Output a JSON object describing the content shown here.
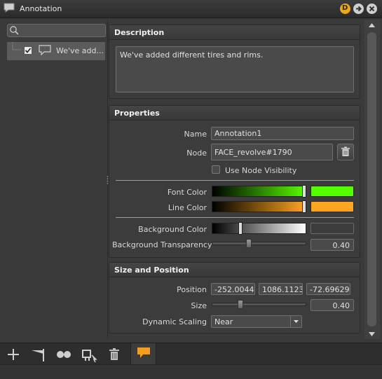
{
  "window": {
    "title": "Annotation"
  },
  "tree": {
    "search_placeholder": "",
    "item_label": "We've add...",
    "item_checked": true
  },
  "description": {
    "header": "Description",
    "text": "We've added different tires and rims."
  },
  "properties": {
    "header": "Properties",
    "name_label": "Name",
    "name_value": "Annotation1",
    "node_label": "Node",
    "node_value": "FACE_revolve#1790",
    "use_node_visibility_label": "Use Node Visibility",
    "font_color_label": "Font Color",
    "font_color": "#55ff00",
    "line_color_label": "Line Color",
    "line_color": "#ffa620",
    "bg_color_label": "Background Color",
    "bg_color": "#3c3c3c",
    "bg_transparency_label": "Background Transparency",
    "bg_transparency_value": "0.40"
  },
  "size_position": {
    "header": "Size and Position",
    "position_label": "Position",
    "position_x": "-252.004425",
    "position_y": "1086.112305",
    "position_z": "-72.696297",
    "size_label": "Size",
    "size_value": "0.40",
    "dynamic_scaling_label": "Dynamic Scaling",
    "dynamic_scaling_value": "Near"
  },
  "toolbar": {
    "icons": [
      "add-icon",
      "flag-icon",
      "dots-icon",
      "node-link-icon",
      "trash-icon",
      "annotation-icon"
    ]
  },
  "colors": {
    "accent_orange": "#e8a820",
    "font_green": "#55ff00",
    "line_orange": "#ffa620"
  }
}
